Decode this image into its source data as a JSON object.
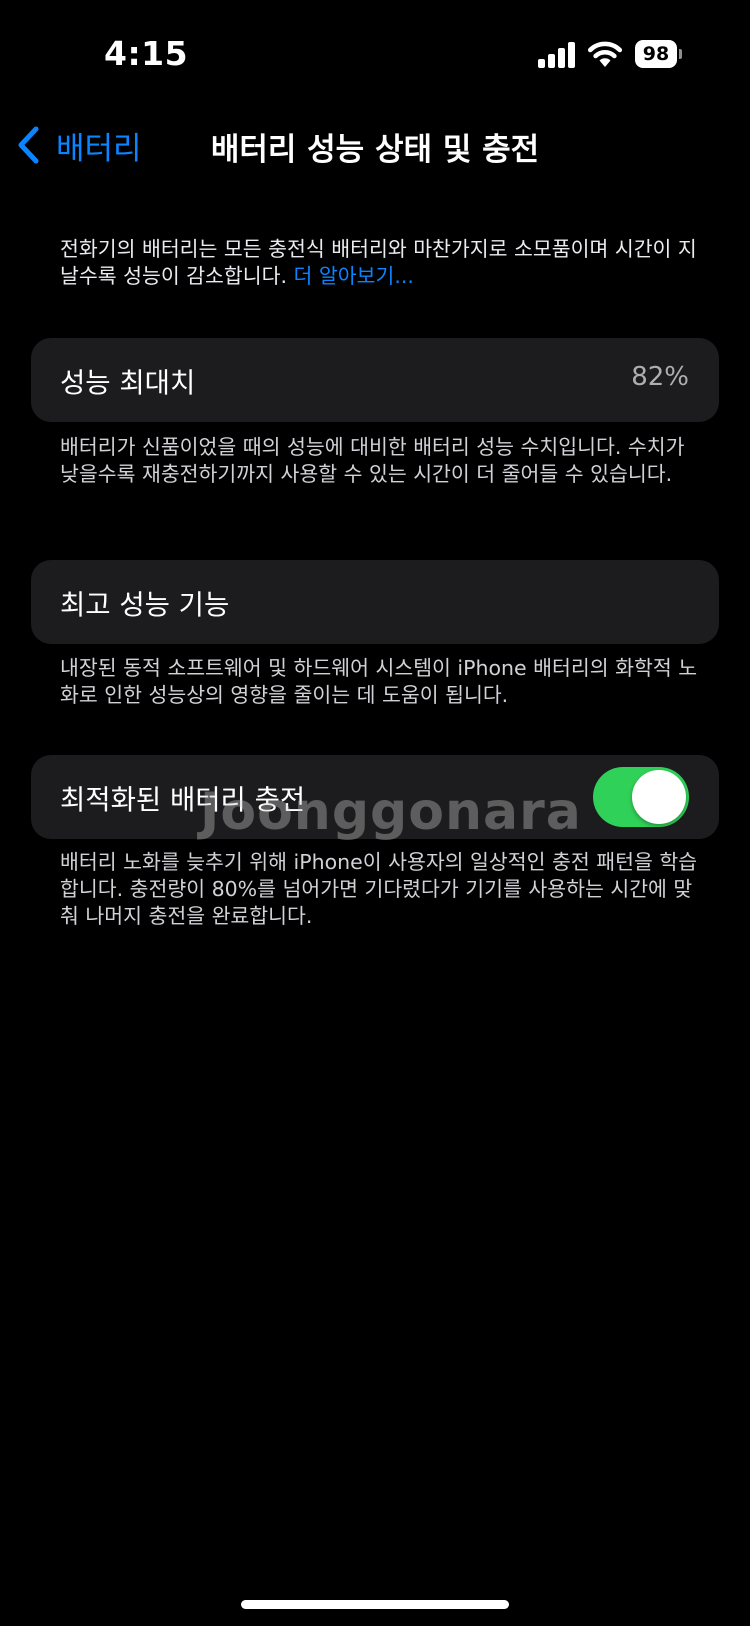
{
  "status_bar": {
    "time": "4:15",
    "battery_level": "98",
    "icons": [
      "cellular-signal-icon",
      "wifi-icon",
      "battery-icon"
    ]
  },
  "nav": {
    "back_label": "배터리",
    "title": "배터리 성능 상태 및 충전"
  },
  "intro": {
    "text": "전화기의 배터리는 모든 충전식 배터리와 마찬가지로 소모품이며 시간이 지날수록 성능이 감소합니다.",
    "link": "더 알아보기..."
  },
  "max_capacity": {
    "label": "성능 최대치",
    "value": "82%",
    "footer": "배터리가 신품이었을 때의 성능에 대비한 배터리 성능 수치입니다. 수치가 낮을수록 재충전하기까지 사용할 수 있는 시간이 더 줄어들 수 있습니다."
  },
  "peak_performance": {
    "label": "최고 성능 기능",
    "footer": "내장된 동적 소프트웨어 및 하드웨어 시스템이 iPhone 배터리의 화학적 노화로 인한 성능상의 영향을 줄이는 데 도움이 됩니다."
  },
  "optimized_charging": {
    "label": "최적화된 배터리 충전",
    "enabled": true,
    "footer": "배터리 노화를 늦추기 위해 iPhone이 사용자의 일상적인 충전 패턴을 학습합니다. 충전량이 80%를 넘어가면 기다렸다가 기기를 사용하는 시간에 맞춰 나머지 충전을 완료합니다."
  },
  "watermark": "Joonggonara",
  "colors": {
    "accent": "#0a84ff",
    "toggle_on": "#30d158",
    "card_bg": "#1c1c1e",
    "background": "#000000"
  }
}
